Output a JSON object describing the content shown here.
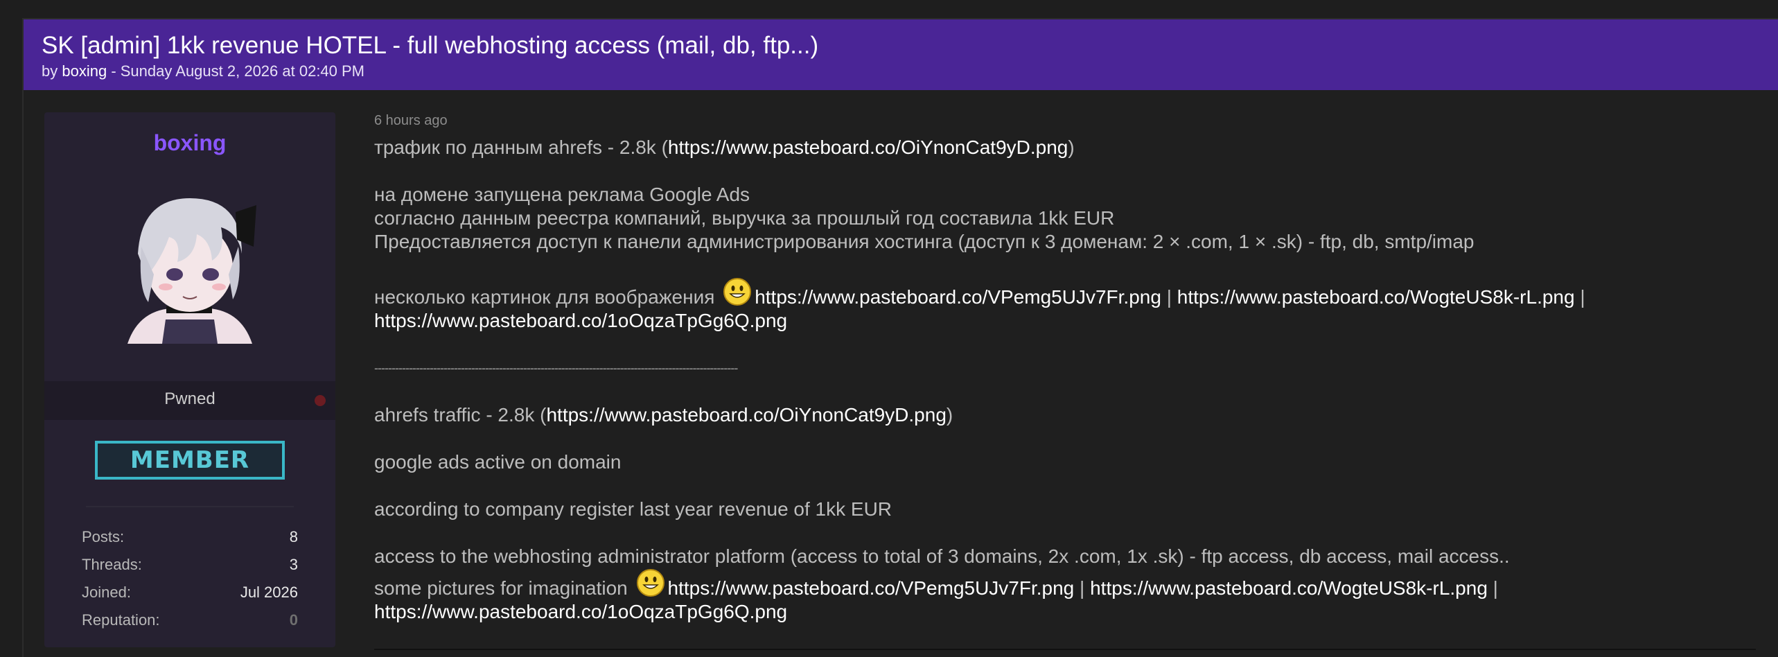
{
  "thread": {
    "title": "SK [admin] 1kk revenue HOTEL - full webhosting access (mail, db, ftp...)",
    "by_prefix": "by ",
    "author": "boxing",
    "date_text": " - Sunday August 2, 2026 at 02:40 PM"
  },
  "profile": {
    "username": "boxing",
    "user_title": "Pwned",
    "badge": "MEMBER",
    "stats": [
      {
        "label": "Posts:",
        "value": "8"
      },
      {
        "label": "Threads:",
        "value": "3"
      },
      {
        "label": "Joined:",
        "value": "Jul 2026"
      },
      {
        "label": "Reputation:",
        "value": "0"
      }
    ]
  },
  "post": {
    "time": "6 hours ago",
    "ru_traffic_text": "трафик по данным ahrefs - 2.8k  (",
    "ru_traffic_url": "https://www.pasteboard.co/OiYnonCat9yD.png",
    "ru_traffic_close": ")",
    "ru_ads": "на домене запущена реклама Google Ads",
    "ru_revenue": "согласно данным реестра компаний, выручка за прошлый год составила 1kk EUR",
    "ru_access": "Предоставляется доступ к панели администрирования хостинга (доступ к 3 доменам: 2 × .com, 1 × .sk) - ftp, db, smtp/imap",
    "ru_pics_text": "несколько картинок для воображения",
    "pic_url_1": "https://www.pasteboard.co/VPemg5UJv7Fr.png",
    "pic_url_2": "https://www.pasteboard.co/WogteUS8k-rL.png",
    "pic_url_3": "https://www.pasteboard.co/1oOqzaTpGg6Q.png",
    "separator_pipe": " | ",
    "divider": "---------------------------------------------------------------------------------------------------------",
    "en_traffic_text": "ahrefs traffic - 2.8k (",
    "en_traffic_url": "https://www.pasteboard.co/OiYnonCat9yD.png",
    "en_traffic_close": ")",
    "en_ads": "google ads active on domain",
    "en_revenue": "according to company register last year revenue of 1kk EUR",
    "en_access": "access to the webhosting administrator platform (access to total of 3 domains, 2x .com, 1x .sk) - ftp access, db access, mail access..",
    "en_pics_text": "some pictures for imagination",
    "smiley_icon": "smiley-face-icon"
  },
  "colors": {
    "header_bg": "#4a2596",
    "username": "#8a56ff",
    "badge": "#58c8d6"
  }
}
